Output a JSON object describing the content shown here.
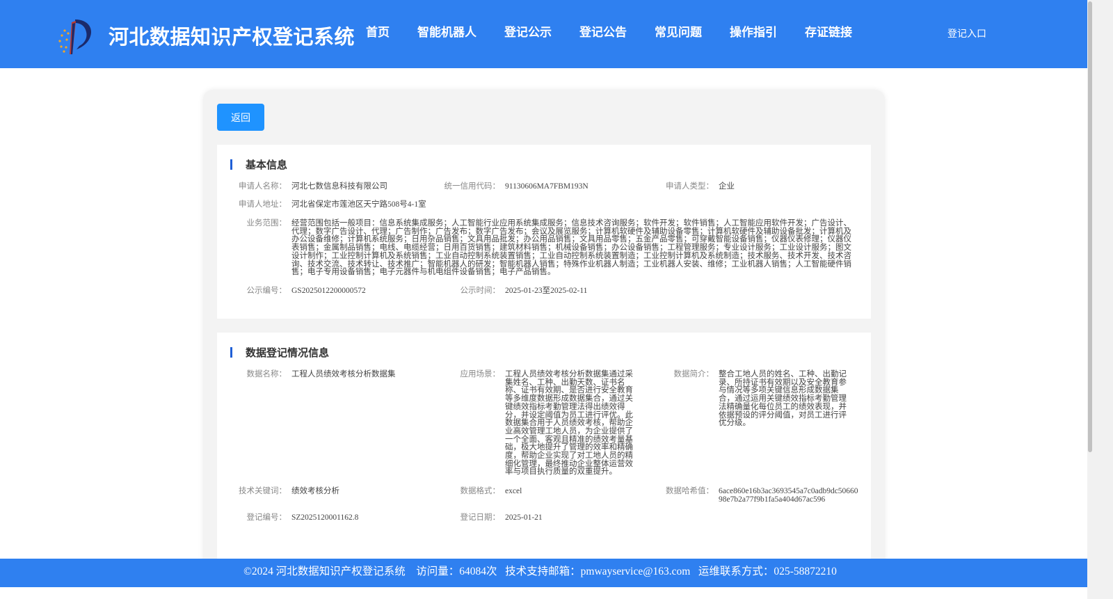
{
  "header": {
    "title": "河北数据知识产权登记系统",
    "nav": [
      "首页",
      "智能机器人",
      "登记公示",
      "登记公告",
      "常见问题",
      "操作指引",
      "存证链接"
    ],
    "login": "登记入口"
  },
  "back_button": "返回",
  "basic_info": {
    "section_title": "基本信息",
    "applicant_name_label": "申请人名称：",
    "applicant_name": "河北七数信息科技有限公司",
    "credit_code_label": "统一信用代码：",
    "credit_code": "91130606MA7FBM193N",
    "applicant_type_label": "申请人类型：",
    "applicant_type": "企业",
    "address_label": "申请人地址：",
    "address": "河北省保定市莲池区天宁路508号4-1室",
    "scope_label": "业务范围：",
    "scope": "经营范围包括一般项目：信息系统集成服务；人工智能行业应用系统集成服务；信息技术咨询服务；软件开发；软件销售；人工智能应用软件开发；广告设计、代理；数字广告设计、代理；广告制作；广告发布；数字广告发布；会议及展览服务；计算机软硬件及辅助设备零售；计算机软硬件及辅助设备批发；计算机及办公设备维修；计算机系统服务；日用杂品销售；文具用品批发；办公用品销售；文具用品零售；五金产品零售；可穿戴智能设备销售；仪器仪表修理；仪器仪表销售；金属制品销售；电线、电缆经营；日用百货销售；建筑材料销售；机械设备销售；办公设备销售；工程管理服务；专业设计服务；工业设计服务；图文设计制作；工业控制计算机及系统销售；工业自动控制系统装置销售；工业自动控制系统装置制造；工业控制计算机及系统制造；技术服务、技术开发、技术咨询、技术交流、技术转让、技术推广；智能机器人的研发；智能机器人销售；特殊作业机器人制造；工业机器人安装、维修；工业机器人销售；人工智能硬件销售；电子专用设备销售；电子元器件与机电组件设备销售；电子产品销售。",
    "pub_no_label": "公示编号：",
    "pub_no": "GS2025012200000572",
    "pub_time_label": "公示时间：",
    "pub_time": "2025-01-23至2025-02-11"
  },
  "data_info": {
    "section_title": "数据登记情况信息",
    "data_name_label": "数据名称：",
    "data_name": "工程人员绩效考核分析数据集",
    "scenario_label": "应用场景：",
    "scenario": "工程人员绩效考核分析数据集通过采集姓名、工种、出勤天数、证书名称、证书有效期、是否进行安全教育等多维度数据形成数据集合，通过关键绩效指标考勤管理法得出绩效得分，并设定阈值为员工进行评优。此数据集合用于人员绩效考核，帮助企业高效管理工地人员，为企业提供了一个全面、客观且精准的绩效考量基础，极大地提升了管理的效率和精确度，帮助企业实现了对工地人员的精细化管理，最终推动企业整体运营效率与项目执行质量的双重提升。",
    "summary_label": "数据简介：",
    "summary": "整合工地人员的姓名、工种、出勤记录、所持证书有效期以及安全教育参与情况等多项关键信息形成数据集合，通过运用关键绩效指标考勤管理法精确量化每位员工的绩效表现，并依据预设的评分阈值，对员工进行评优分级。",
    "keywords_label": "技术关键词：",
    "keywords": "绩效考核分析",
    "format_label": "数据格式：",
    "format": "excel",
    "hash_label": "数据哈希值：",
    "hash": "6ace860e16b3ac3693545a7c0adb9dc5066098e7b2a77f9b1fa5a404d67ac596",
    "reg_no_label": "登记编号：",
    "reg_no": "SZ2025120001162.8",
    "reg_date_label": "登记日期：",
    "reg_date": "2025-01-21"
  },
  "footer": {
    "text": "©2024 河北数据知识产权登记系统    访问量：64084次   技术支持邮箱：pmwayservice@163.com   运维联系方式：025-58872210"
  },
  "colors": {
    "brand_blue": "#2f80f0",
    "button_blue": "#1f93ff",
    "section_bar": "#1f5fd6"
  }
}
